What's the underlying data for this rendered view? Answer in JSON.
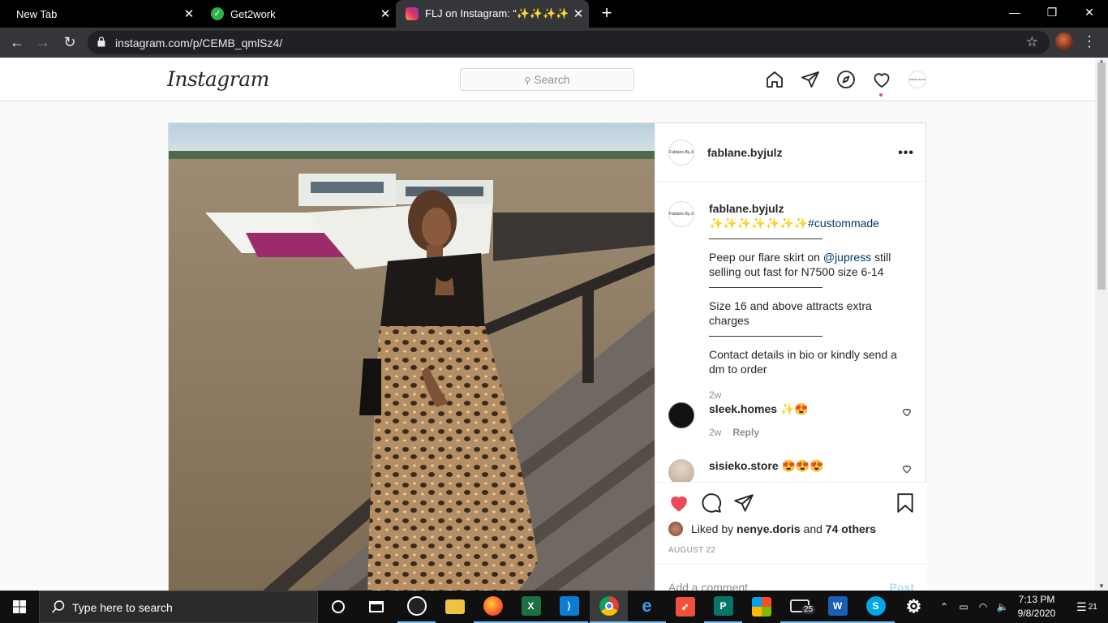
{
  "browser": {
    "tabs": [
      {
        "title": "New Tab",
        "close": "✕"
      },
      {
        "title": "Get2work",
        "close": "✕"
      },
      {
        "title": "FLJ on Instagram: “✨✨✨✨✨✨✨",
        "close": "✕",
        "active": true
      }
    ],
    "new_tab": "+",
    "url": "instagram.com/p/CEMB_qmlSz4/",
    "window_controls": {
      "minimize": "—",
      "maximize": "❐",
      "close": "✕"
    }
  },
  "instagram": {
    "logo": "Instagram",
    "search_placeholder": "Search",
    "nav_icons": [
      "home-icon",
      "direct-icon",
      "explore-icon",
      "heart-icon",
      "profile-avatar"
    ],
    "nav_avatar_text": "Fablane.By.Julz"
  },
  "post": {
    "username": "fablane.byjulz",
    "avatar_text": "Fablane.By.Julz",
    "more": "•••",
    "caption": {
      "username": "fablane.byjulz",
      "emoji_line": "✨✨✨✨✨✨✨",
      "hashtag": "#custommade",
      "divider": "——————————",
      "line1_pre": "Peep our flare skirt on ",
      "mention": "@jupress",
      "line1_post": " still selling out fast for N7500 size 6-14",
      "line2": "Size 16 and above attracts extra charges",
      "line3": "Contact details in bio or kindly send a dm to order",
      "time": "2w"
    },
    "comments": [
      {
        "username": "sleek.homes",
        "text": "✨😍",
        "time": "2w",
        "reply": "Reply"
      },
      {
        "username": "sisieko.store",
        "text": "😍😍😍"
      }
    ],
    "liked_by_prefix": "Liked by ",
    "liked_by_user": "nenye.doris",
    "liked_by_and": " and ",
    "liked_by_others": "74 others",
    "date": "AUGUST 22",
    "add_comment_placeholder": "Add a comment…",
    "post_button": "Post",
    "liked": true,
    "colors": {
      "like_red": "#ed4956",
      "link_blue": "#00376b"
    }
  },
  "taskbar": {
    "search_placeholder": "Type here to search",
    "apps": [
      "cortana",
      "task-view",
      "obs",
      "file-explorer",
      "firefox",
      "excel",
      "vscode",
      "chrome",
      "edge",
      "swift",
      "publisher",
      "store",
      "mail",
      "word",
      "skype",
      "settings"
    ],
    "mail_badge": "25",
    "time": "7:13 PM",
    "date": "9/8/2020",
    "notification_count": "21"
  }
}
